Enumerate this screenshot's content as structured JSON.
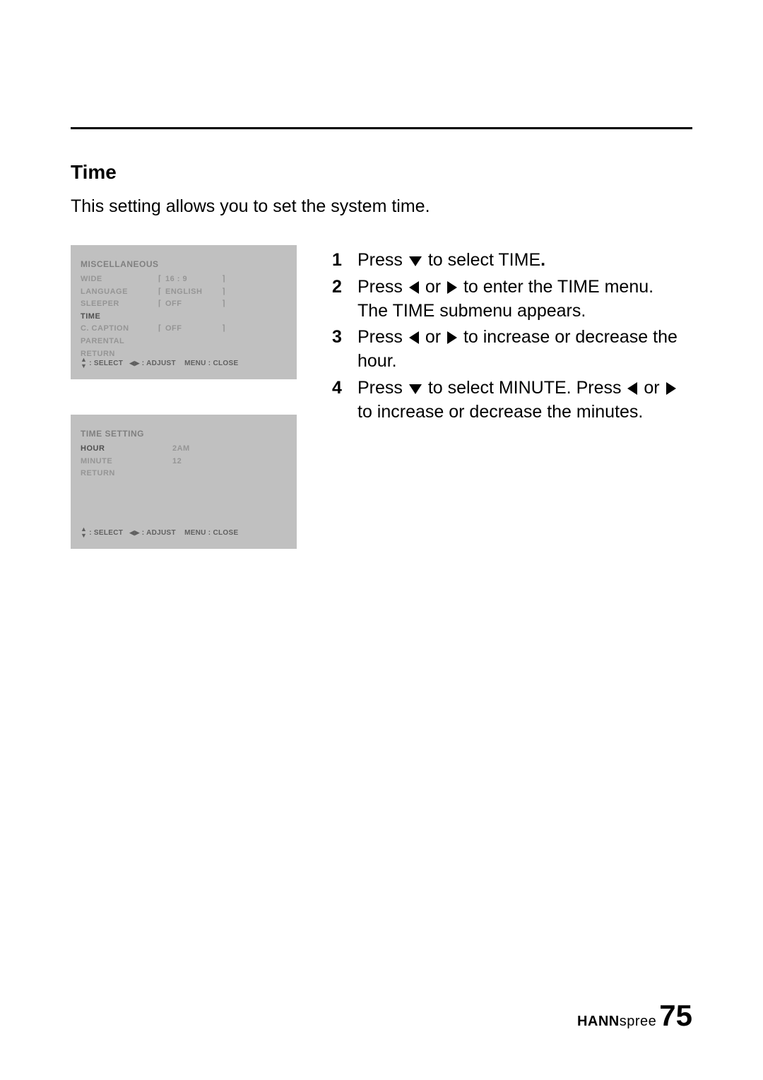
{
  "section": {
    "title": "Time",
    "description": "This setting allows you to set the system time."
  },
  "osd1": {
    "title": "MISCELLANEOUS",
    "rows": {
      "wide_label": "WIDE",
      "wide_val": "16 : 9",
      "language_label": "LANGUAGE",
      "language_val": "ENGLISH",
      "sleeper_label": "SLEEPER",
      "sleeper_val": "OFF",
      "time_label": "TIME",
      "caption_label": "C. CAPTION",
      "caption_val": "OFF",
      "parental_label": "PARENTAL",
      "return_label": "RETURN"
    },
    "footer": {
      "select": ": SELECT",
      "adjust": ": ADJUST",
      "menu": "MENU : CLOSE"
    }
  },
  "osd2": {
    "title": "TIME SETTING",
    "rows": {
      "hour_label": "HOUR",
      "hour_val": "2AM",
      "minute_label": "MINUTE",
      "minute_val": "12",
      "return_label": "RETURN"
    },
    "footer": {
      "select": ": SELECT",
      "adjust": ": ADJUST",
      "menu": "MENU : CLOSE"
    }
  },
  "steps": {
    "s1_a": "Press ",
    "s1_b": " to select TIME",
    "s1_c": ".",
    "s2_a": "Press ",
    "s2_b": " or ",
    "s2_c": " to enter the TIME menu.",
    "s2_d": "The TIME submenu appears.",
    "s3_a": "Press ",
    "s3_b": " or ",
    "s3_c": " to increase or decrease the hour.",
    "s4_a": "Press ",
    "s4_b": " to select MINUTE. Press ",
    "s4_c": " or ",
    "s4_d": " to increase or decrease the minutes."
  },
  "brand": {
    "bold": "HANN",
    "light": "spree"
  },
  "page_number": "75"
}
